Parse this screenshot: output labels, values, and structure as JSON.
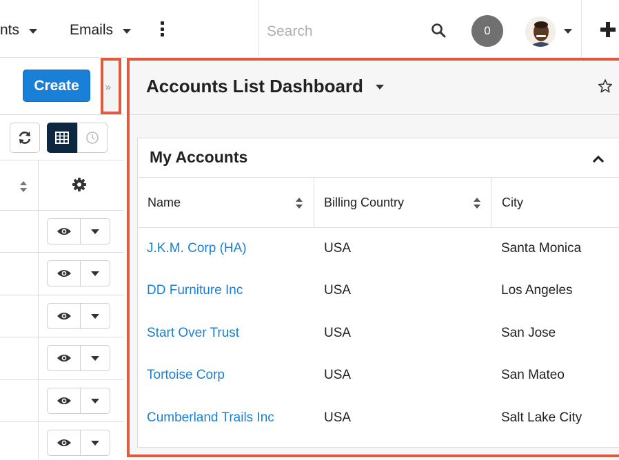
{
  "nav": {
    "item1": "nts",
    "item2": "Emails",
    "search_placeholder": "Search",
    "notification_count": "0"
  },
  "list": {
    "create_label": "Create",
    "toggle_label": "»",
    "rows": 6
  },
  "dashboard": {
    "title": "Accounts List Dashboard",
    "dashlet": {
      "title": "My Accounts",
      "columns": [
        "Name",
        "Billing Country",
        "City"
      ],
      "rows": [
        {
          "name": "J.K.M. Corp (HA)",
          "country": "USA",
          "city": "Santa Monica"
        },
        {
          "name": "DD Furniture Inc",
          "country": "USA",
          "city": "Los Angeles"
        },
        {
          "name": "Start Over Trust",
          "country": "USA",
          "city": "San Jose"
        },
        {
          "name": "Tortoise Corp",
          "country": "USA",
          "city": "San Mateo"
        },
        {
          "name": "Cumberland Trails Inc",
          "country": "USA",
          "city": "Salt Lake City"
        }
      ]
    }
  },
  "colors": {
    "link": "#1a7fd6",
    "create_button": "#1a7fd6",
    "highlight": "#e05a3d",
    "active_toggle": "#0d2740"
  }
}
